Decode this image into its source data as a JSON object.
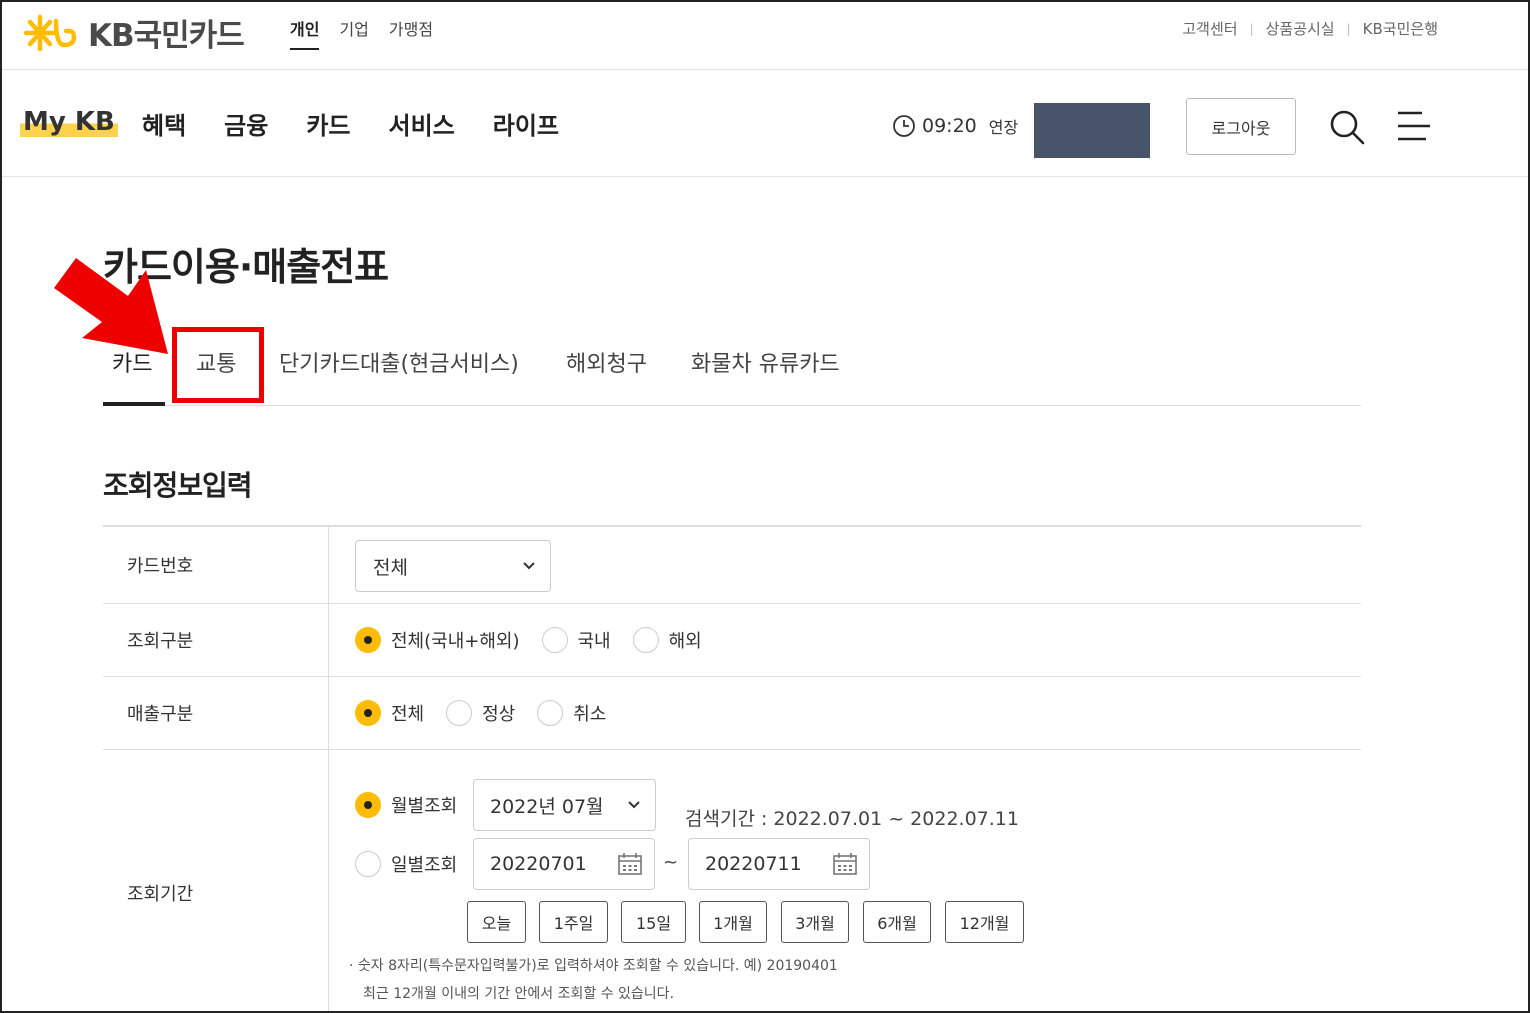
{
  "brand": {
    "logo_text": "KB국민카드"
  },
  "segments": [
    "개인",
    "기업",
    "가맹점"
  ],
  "utility_links": [
    "고객센터",
    "상품공시실",
    "KB국민은행"
  ],
  "nav": {
    "mykb": "My KB",
    "items": [
      "혜택",
      "금융",
      "카드",
      "서비스",
      "라이프"
    ],
    "session_time": "09:20",
    "extend_label": "연장",
    "logout_label": "로그아웃"
  },
  "page": {
    "title": "카드이용·매출전표"
  },
  "tabs": [
    "카드",
    "교통",
    "단기카드대출(현금서비스)",
    "해외청구",
    "화물차 유류카드"
  ],
  "form": {
    "section_title": "조회정보입력",
    "card_number": {
      "label": "카드번호",
      "value": "전체"
    },
    "inquiry_type": {
      "label": "조회구분",
      "options": [
        "전체(국내+해외)",
        "국내",
        "해외"
      ],
      "selected": "전체(국내+해외)"
    },
    "sales_type": {
      "label": "매출구분",
      "options": [
        "전체",
        "정상",
        "취소"
      ],
      "selected": "전체"
    },
    "period": {
      "label": "조회기간",
      "monthly_label": "월별조회",
      "daily_label": "일별조회",
      "month_value": "2022년 07월",
      "search_range": "검색기간 : 2022.07.01 ~ 2022.07.11",
      "start_date": "20220701",
      "end_date": "20220711",
      "tilde": "~",
      "quick_buttons": [
        "오늘",
        "1주일",
        "15일",
        "1개월",
        "3개월",
        "6개월",
        "12개월"
      ],
      "note_1": "· 숫자 8자리(특수문자입력불가)로 입력하셔야 조회할 수 있습니다. 예) 20190401",
      "note_2": "최근 12개월 이내의 기간 안에서 조회할 수 있습니다."
    }
  },
  "colors": {
    "brand_yellow": "#ffbc00",
    "highlight_red": "#ee0000",
    "masked_block": "#475469"
  }
}
